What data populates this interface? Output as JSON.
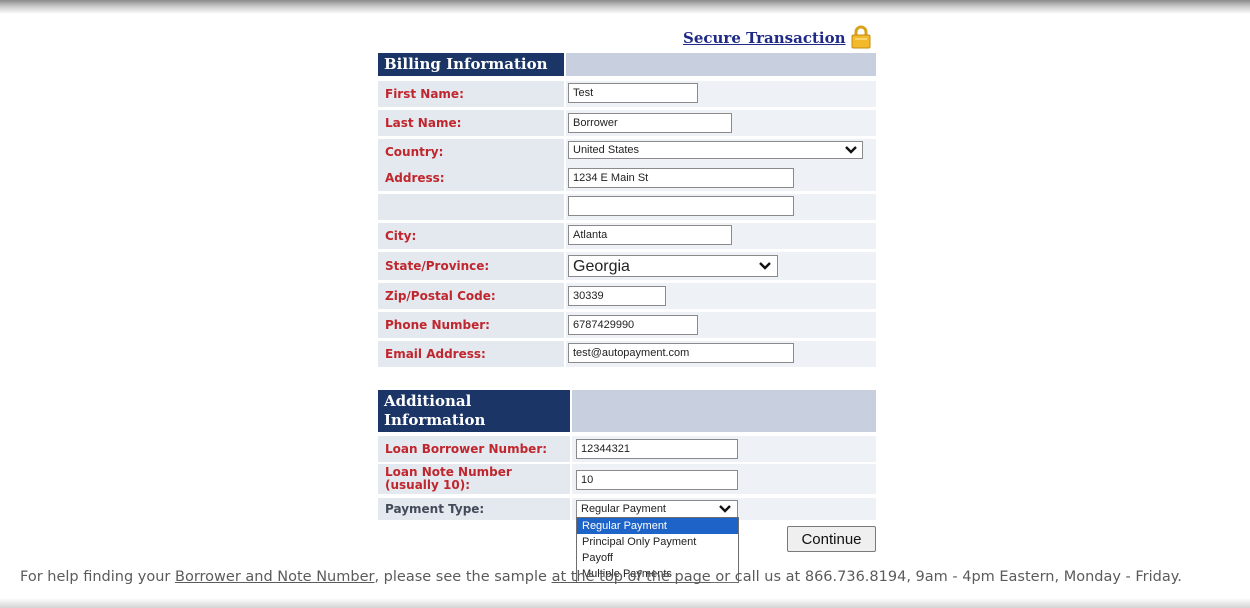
{
  "secure": {
    "label": "Secure Transaction"
  },
  "billing": {
    "header": "Billing Information",
    "first_name": {
      "label": "First Name:",
      "value": "Test"
    },
    "last_name": {
      "label": "Last Name:",
      "value": "Borrower"
    },
    "country": {
      "label": "Country:",
      "value": "United States"
    },
    "address": {
      "label": "Address:",
      "value": "1234 E Main St",
      "value2": ""
    },
    "city": {
      "label": "City:",
      "value": "Atlanta"
    },
    "state": {
      "label": "State/Province:",
      "value": "Georgia"
    },
    "zip": {
      "label": "Zip/Postal Code:",
      "value": "30339"
    },
    "phone": {
      "label": "Phone Number:",
      "value": "6787429990"
    },
    "email": {
      "label": "Email Address:",
      "value": "test@autopayment.com"
    }
  },
  "additional": {
    "header_line1": "Additional",
    "header_line2": "Information",
    "borrower_number": {
      "label": "Loan Borrower Number:",
      "value": "12344321"
    },
    "note_number": {
      "label_line1": "Loan Note Number",
      "label_line2": "(usually 10):",
      "value": "10"
    },
    "payment_type": {
      "label": "Payment Type:",
      "value": "Regular Payment",
      "options": [
        "Regular Payment",
        "Principal Only Payment",
        "Payoff",
        "Multiple Payments"
      ],
      "highlighted": "Regular Payment"
    }
  },
  "continue_label": "Continue",
  "help": {
    "prefix": "For help finding your ",
    "link": "Borrower and Note Number",
    "middle": ", please see the sample ",
    "hidden_link": "at the top of the page",
    "suffix": " or call us at 866.736.8194, 9am - 4pm Eastern, Monday - Friday."
  },
  "colors": {
    "header_bg": "#1b3566",
    "label_red": "#c0262d",
    "link_blue": "#1f2a86",
    "selection_blue": "#1e63c8"
  }
}
